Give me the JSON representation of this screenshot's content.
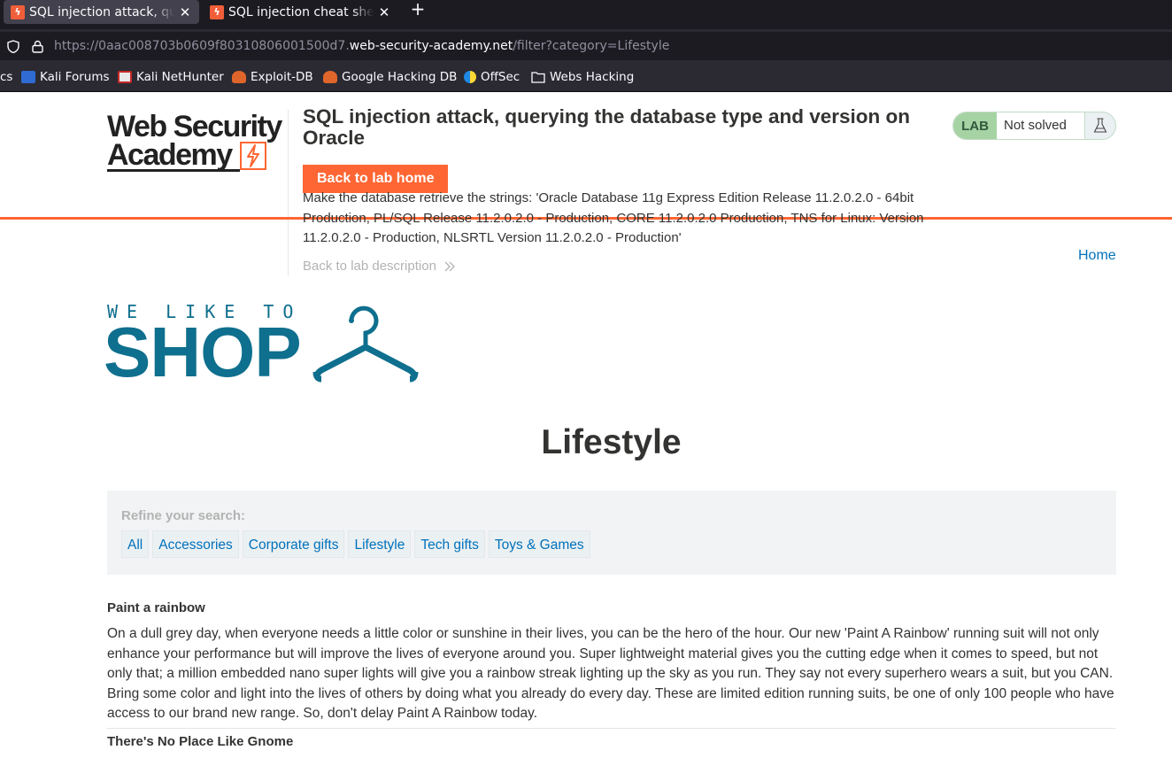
{
  "browser": {
    "tabs": [
      {
        "title": "SQL injection attack, querying the database type and version on Oracle",
        "active": true
      },
      {
        "title": "SQL injection cheat sheet",
        "active": false
      }
    ],
    "url_prefix": "https://0aac008703b0609f80310806001500d7.",
    "url_domain": "web-security-academy.net",
    "url_path": "/filter?category=Lifestyle",
    "bookmarks": [
      {
        "label": "cs",
        "icon": "partial-bookmark-icon"
      },
      {
        "label": "Kali Forums",
        "icon": "kali-forums-icon"
      },
      {
        "label": "Kali NetHunter",
        "icon": "kali-nethunter-icon"
      },
      {
        "label": "Exploit-DB",
        "icon": "exploit-db-icon"
      },
      {
        "label": "Google Hacking DB",
        "icon": "google-hacking-db-icon"
      },
      {
        "label": "OffSec",
        "icon": "offsec-icon"
      },
      {
        "label": "Webs Hacking",
        "icon": "folder-icon"
      }
    ]
  },
  "academy": {
    "logo_line1": "Web Security",
    "logo_line2": "Academy",
    "lab_title": "SQL injection attack, querying the database type and version on Oracle",
    "back_button": "Back to lab home",
    "lab_description": "Make the database retrieve the strings: 'Oracle Database 11g Express Edition Release 11.2.0.2.0 - 64bit Production, PL/SQL Release 11.2.0.2.0 - Production, CORE 11.2.0.2.0 Production, TNS for Linux: Version 11.2.0.2.0 - Production, NLSRTL Version 11.2.0.2.0 - Production'",
    "back_to_description": "Back to lab description",
    "badge_label": "LAB",
    "badge_status": "Not solved",
    "home_link": "Home",
    "accent": "#ff6633"
  },
  "shop": {
    "tagline": "WE LIKE TO",
    "word": "SHOP",
    "color": "#0f6f8e",
    "category_title": "Lifestyle",
    "refine_label": "Refine your search:",
    "filters": [
      "All",
      "Accessories",
      "Corporate gifts",
      "Lifestyle",
      "Tech gifts",
      "Toys & Games"
    ],
    "posts": [
      {
        "title": "Paint a rainbow",
        "body": "On a dull grey day, when everyone needs a little color or sunshine in their lives, you can be the hero of the hour. Our new 'Paint A Rainbow' running suit will not only enhance your performance but will improve the lives of everyone around you. Super lightweight material gives you the cutting edge when it comes to speed, but not only that; a million embedded nano super lights will give you a rainbow streak lighting up the sky as you run. They say not every superhero wears a suit, but you CAN. Bring some color and light into the lives of others by doing what you already do every day. These are limited edition running suits, be one of only 100 people who have access to our brand new range. So, don't delay Paint A Rainbow today."
      },
      {
        "title": "There's No Place Like Gnome",
        "body": ""
      }
    ]
  }
}
